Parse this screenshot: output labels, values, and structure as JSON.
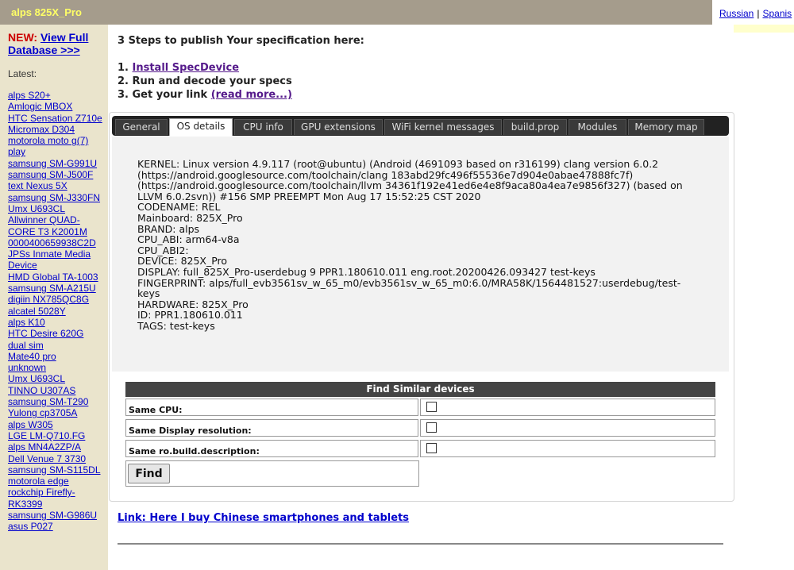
{
  "header": {
    "title": "alps 825X_Pro",
    "languages": [
      "Russian",
      "Spanis"
    ],
    "separator": "|"
  },
  "sidebar": {
    "new_label": "NEW:",
    "view_full_link": "View Full Database >>>",
    "latest_label": "Latest:",
    "devices": [
      "alps S20+",
      "Amlogic MBOX",
      "HTC Sensation Z710e",
      "Micromax D304",
      "motorola moto g(7) play",
      "samsung SM-G991U",
      "samsung SM-J500F",
      "text Nexus 5X",
      "samsung SM-J330FN",
      "Umx U693CL",
      "Allwinner QUAD-CORE T3 K2001M",
      "0000400659938C2D",
      "JPSs Inmate Media Device",
      "HMD Global TA-1003",
      "samsung SM-A215U",
      "digiin NX785QC8G",
      "alcatel 5028Y",
      "alps K10",
      "HTC Desire 620G",
      "dual sim",
      "Mate40 pro",
      "unknown",
      "Umx U693CL",
      "TINNO U307AS",
      "samsung SM-T290",
      "Yulong cp3705A",
      "alps W305",
      "LGE LM-Q710.FG",
      "alps MN4A2ZP/A",
      "Dell Venue 7 3730",
      "samsung SM-S115DL",
      "motorola edge",
      "rockchip Firefly-RK3399",
      "samsung SM-G986U",
      "asus P027"
    ]
  },
  "steps": {
    "title": "3 Steps to publish Your specification here:",
    "step1_prefix": "1.",
    "step1_link": "Install SpecDevice",
    "step2": "2. Run and decode your specs",
    "step3_prefix": "3. Get your link",
    "step3_link": "(read more...)"
  },
  "tabs": [
    {
      "label": "General"
    },
    {
      "label": "OS details"
    },
    {
      "label": "CPU info"
    },
    {
      "label": "GPU extensions"
    },
    {
      "label": "WiFi kernel messages"
    },
    {
      "label": "build.prop"
    },
    {
      "label": "Modules"
    },
    {
      "label": "Memory map"
    }
  ],
  "active_tab": "OS details",
  "os_details": [
    "KERNEL: Linux version 4.9.117 (root@ubuntu) (Android (4691093 based on r316199) clang version 6.0.2 (https://android.googlesource.com/toolchain/clang 183abd29fc496f55536e7d904e0abae47888fc7f) (https://android.googlesource.com/toolchain/llvm 34361f192e41ed6e4e8f9aca80a4ea7e9856f327) (based on LLVM 6.0.2svn)) #156 SMP PREEMPT Mon Aug 17 15:52:25 CST 2020",
    "CODENAME: REL",
    "Mainboard: 825X_Pro",
    "BRAND: alps",
    "CPU_ABI: arm64-v8a",
    "CPU_ABI2:",
    "DEVICE: 825X_Pro",
    "DISPLAY: full_825X_Pro-userdebug 9 PPR1.180610.011 eng.root.20200426.093427 test-keys",
    "FINGERPRINT: alps/full_evb3561sv_w_65_m0/evb3561sv_w_65_m0:6.0/MRA58K/1564481527:userdebug/test-keys",
    "HARDWARE: 825X_Pro",
    "ID: PPR1.180610.011",
    "TAGS: test-keys"
  ],
  "find_similar": {
    "header": "Find Similar devices",
    "rows": [
      {
        "label": "Same CPU:",
        "checked": false
      },
      {
        "label": "Same Display resolution:",
        "checked": false
      },
      {
        "label": "Same ro.build.description:",
        "checked": false
      }
    ],
    "button": "Find"
  },
  "footer_link": "Link: Here I buy Chinese smartphones and tablets"
}
